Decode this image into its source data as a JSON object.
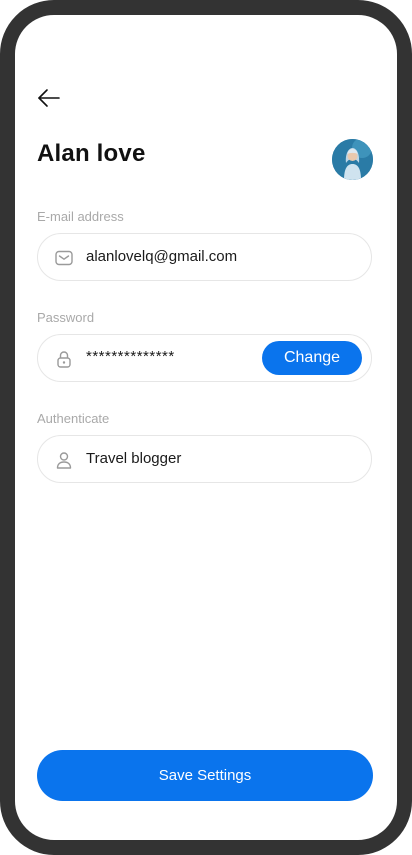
{
  "header": {
    "back_icon": "arrow-left-icon",
    "title": "Alan love",
    "avatar_icon": "user-photo-avatar"
  },
  "email": {
    "label": "E-mail address",
    "value": "alanlovelq@gmail.com",
    "icon": "mail-icon"
  },
  "password": {
    "label": "Password",
    "value": "**************",
    "icon": "lock-icon",
    "change_label": "Change"
  },
  "authenticate": {
    "label": "Authenticate",
    "value": "Travel blogger",
    "icon": "user-icon"
  },
  "footer": {
    "save_label": "Save Settings"
  },
  "colors": {
    "accent": "#0a74ed",
    "frame": "#333333",
    "label": "#a9a9a9",
    "border": "#e6e6e6"
  }
}
